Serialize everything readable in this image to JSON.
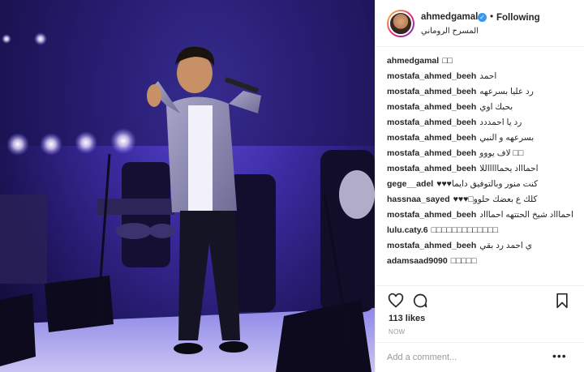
{
  "header": {
    "username": "ahmedgamal",
    "follow_status": "Following",
    "location": "المسرح الروماني"
  },
  "comments": [
    {
      "user": "ahmedgamal",
      "text": "□□"
    },
    {
      "user": "mostafa_ahmed_beeh",
      "text": "احمد"
    },
    {
      "user": "mostafa_ahmed_beeh",
      "text": "رد عليا بسرعهه"
    },
    {
      "user": "mostafa_ahmed_beeh",
      "text": "بحبك اوي"
    },
    {
      "user": "mostafa_ahmed_beeh",
      "text": "رد يا احمددد"
    },
    {
      "user": "mostafa_ahmed_beeh",
      "text": "بسرعهه و النبي"
    },
    {
      "user": "mostafa_ahmed_beeh",
      "text": "لاف يووو □□"
    },
    {
      "user": "mostafa_ahmed_beeh",
      "text": "احماااد يحماااااللا"
    },
    {
      "user": "gege__adel",
      "text": "♥♥♥كنت منور وبالتوفيق دايما"
    },
    {
      "user": "hassnaa_sayed",
      "text": "♥♥♥□كلك ع بعضك حلوو"
    },
    {
      "user": "mostafa_ahmed_beeh",
      "text": "احماااد شيخ الحتتهه احماااد □"
    },
    {
      "user": "lulu.caty.6",
      "text": "□□□□□□□□□□□□□"
    },
    {
      "user": "mostafa_ahmed_beeh",
      "text": "ي احمد رد بقي"
    },
    {
      "user": "adamsaad9090",
      "text": "□□□□□"
    }
  ],
  "footer": {
    "likes": "113 likes",
    "timestamp": "NOW",
    "add_comment_placeholder": "Add a comment...",
    "more_label": "•••"
  },
  "icons": {
    "like": "heart-icon",
    "comment": "comment-icon",
    "save": "bookmark-icon",
    "verified": "verified-badge-icon",
    "more": "more-options-icon"
  },
  "colors": {
    "verified": "#3897f0",
    "text": "#262626",
    "muted": "#999999",
    "stage_light": "#5a49d8"
  }
}
